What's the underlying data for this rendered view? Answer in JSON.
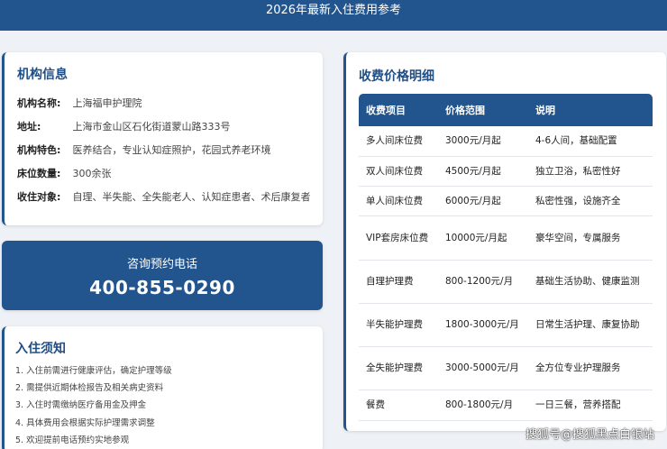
{
  "header": {
    "title": "2026年最新入住费用参考"
  },
  "institution": {
    "title": "机构信息",
    "rows": [
      {
        "label": "机构名称:",
        "value": "上海福申护理院"
      },
      {
        "label": "地址:",
        "value": "上海市金山区石化街道蒙山路333号"
      },
      {
        "label": "机构特色:",
        "value": "医养结合，专业认知症照护，花园式养老环境"
      },
      {
        "label": "床位数量:",
        "value": "300余张"
      },
      {
        "label": "收住对象:",
        "value": "自理、半失能、全失能老人、认知症患者、术后康复者"
      }
    ]
  },
  "phone": {
    "label": "咨询预约电话",
    "number": "400-855-0290"
  },
  "notice": {
    "title": "入住须知",
    "items": [
      "1. 入住前需进行健康评估，确定护理等级",
      "2. 需提供近期体检报告及相关病史资料",
      "3. 入住时需缴纳医疗备用金及押金",
      "4. 具体费用会根据实际护理需求调整",
      "5. 欢迎提前电话预约实地参观"
    ]
  },
  "pricing": {
    "title": "收费价格明细",
    "headers": [
      "收费项目",
      "价格范围",
      "说明"
    ],
    "rows": [
      {
        "item": "多人间床位费",
        "price": "3000元/月起",
        "note": "4-6人间，基础配置"
      },
      {
        "item": "双人间床位费",
        "price": "4500元/月起",
        "note": "独立卫浴，私密性好"
      },
      {
        "item": "单人间床位费",
        "price": "6000元/月起",
        "note": "私密性强，设施齐全"
      },
      {
        "item": "VIP套房床位费",
        "price": "10000元/月起",
        "note": "豪华空间，专属服务"
      },
      {
        "item": "自理护理费",
        "price": "800-1200元/月",
        "note": "基础生活协助、健康监测"
      },
      {
        "item": "半失能护理费",
        "price": "1800-3000元/月",
        "note": "日常生活护理、康复协助"
      },
      {
        "item": "全失能护理费",
        "price": "3000-5000元/月",
        "note": "全方位专业护理服务"
      },
      {
        "item": "餐费",
        "price": "800-1800元/月",
        "note": "一日三餐，营养搭配"
      }
    ]
  },
  "watermark": "搜狐号@搜狐黑点白银站"
}
